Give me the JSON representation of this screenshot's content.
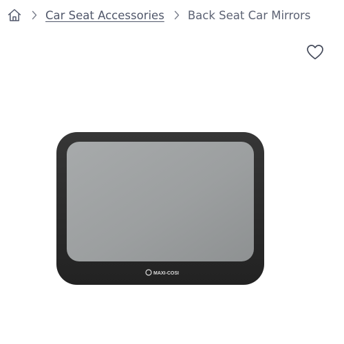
{
  "breadcrumb": {
    "home_icon": "home-icon",
    "separator_icon": "chevron-right-icon",
    "items": [
      {
        "label": "Car Seat Accessories"
      },
      {
        "label": "Back Seat Car Mirrors"
      }
    ]
  },
  "wishlist": {
    "icon": "heart-icon"
  },
  "product": {
    "brand_logo_text": "MAXI-COSI"
  },
  "colors": {
    "text": "#50576a",
    "icon": "#444a5a",
    "mirror_frame": "#2b2b2b",
    "mirror_glass": "#9ea1a2"
  }
}
